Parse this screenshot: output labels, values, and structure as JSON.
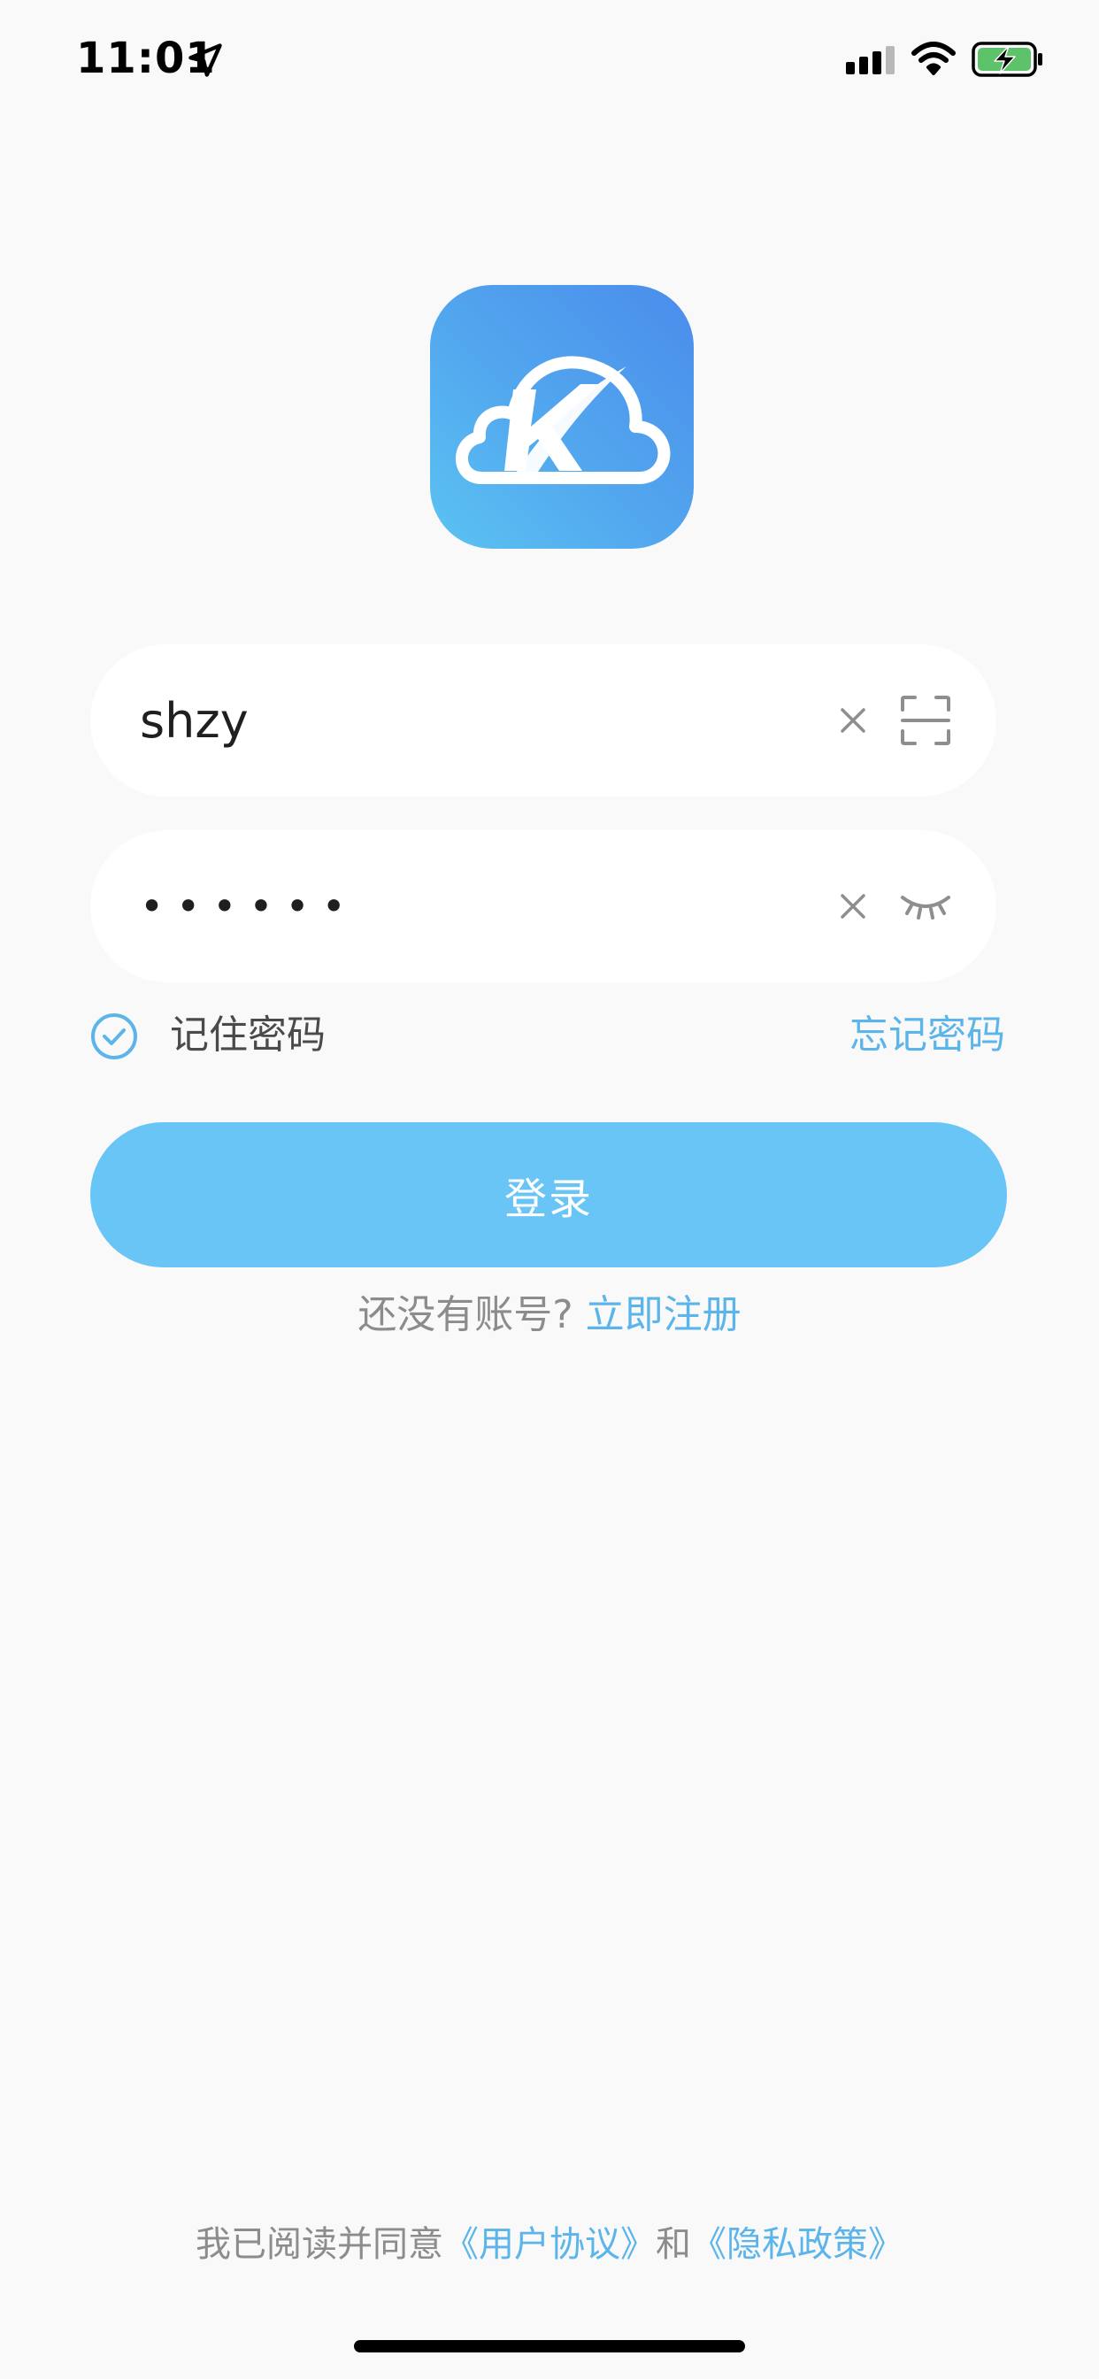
{
  "status_bar": {
    "time": "11:01"
  },
  "login_form": {
    "username_value": "shzy",
    "password_value": "••••••",
    "remember_label": "记住密码",
    "forgot_label": "忘记密码",
    "login_label": "登录"
  },
  "register": {
    "prompt": "还没有账号?",
    "link": "立即注册"
  },
  "agreement": {
    "prefix": "我已阅读并同意",
    "user_agreement": "《用户协议》",
    "conjunction": "和",
    "privacy_policy": "《隐私政策》"
  },
  "colors": {
    "background": "#f9f9fa",
    "accent": "#5bb5ea",
    "button": "#68c5f6"
  }
}
